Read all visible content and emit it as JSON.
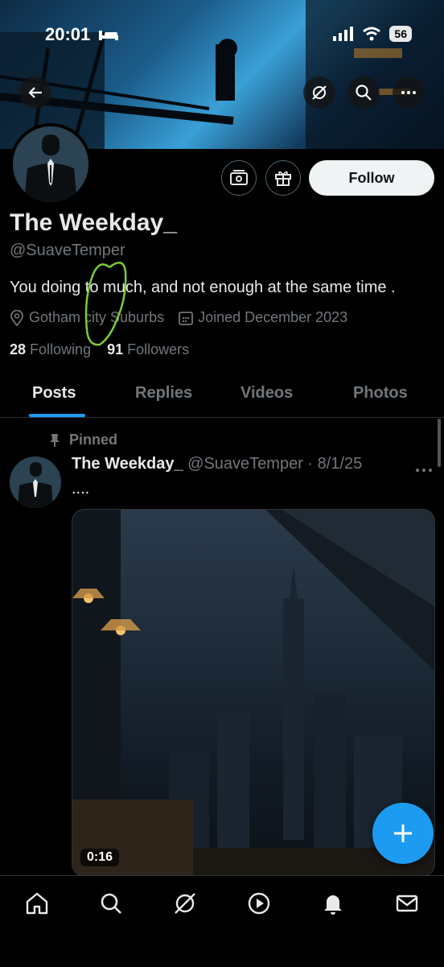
{
  "status_bar": {
    "time": "20:01",
    "battery": "56"
  },
  "profile": {
    "name": "The Weekday_",
    "handle": "@SuaveTemper",
    "bio": "You doing to much, and not enough at the same time .",
    "location": "Gotham city Suburbs",
    "joined": "Joined December 2023",
    "following_count": "28",
    "following_label": "Following",
    "followers_count": "91",
    "followers_label": "Followers",
    "follow_label": "Follow"
  },
  "tabs": [
    {
      "label": "Posts",
      "active": true
    },
    {
      "label": "Replies",
      "active": false
    },
    {
      "label": "Videos",
      "active": false
    },
    {
      "label": "Photos",
      "active": false
    }
  ],
  "pinned_post": {
    "pinned_label": "Pinned",
    "author": "The Weekday_",
    "meta": "@SuaveTemper · 8/1/25",
    "text": "....",
    "video_duration": "0:16"
  },
  "icons": {
    "back": "back-arrow-icon",
    "grok": "grok-icon",
    "search": "search-icon",
    "more": "more-icon",
    "home": "home-icon",
    "notifications": "bell-icon",
    "messages": "mail-icon",
    "compose": "plus-icon"
  },
  "colors": {
    "accent": "#1d9bf0",
    "annotation": "#7ccb3b"
  }
}
